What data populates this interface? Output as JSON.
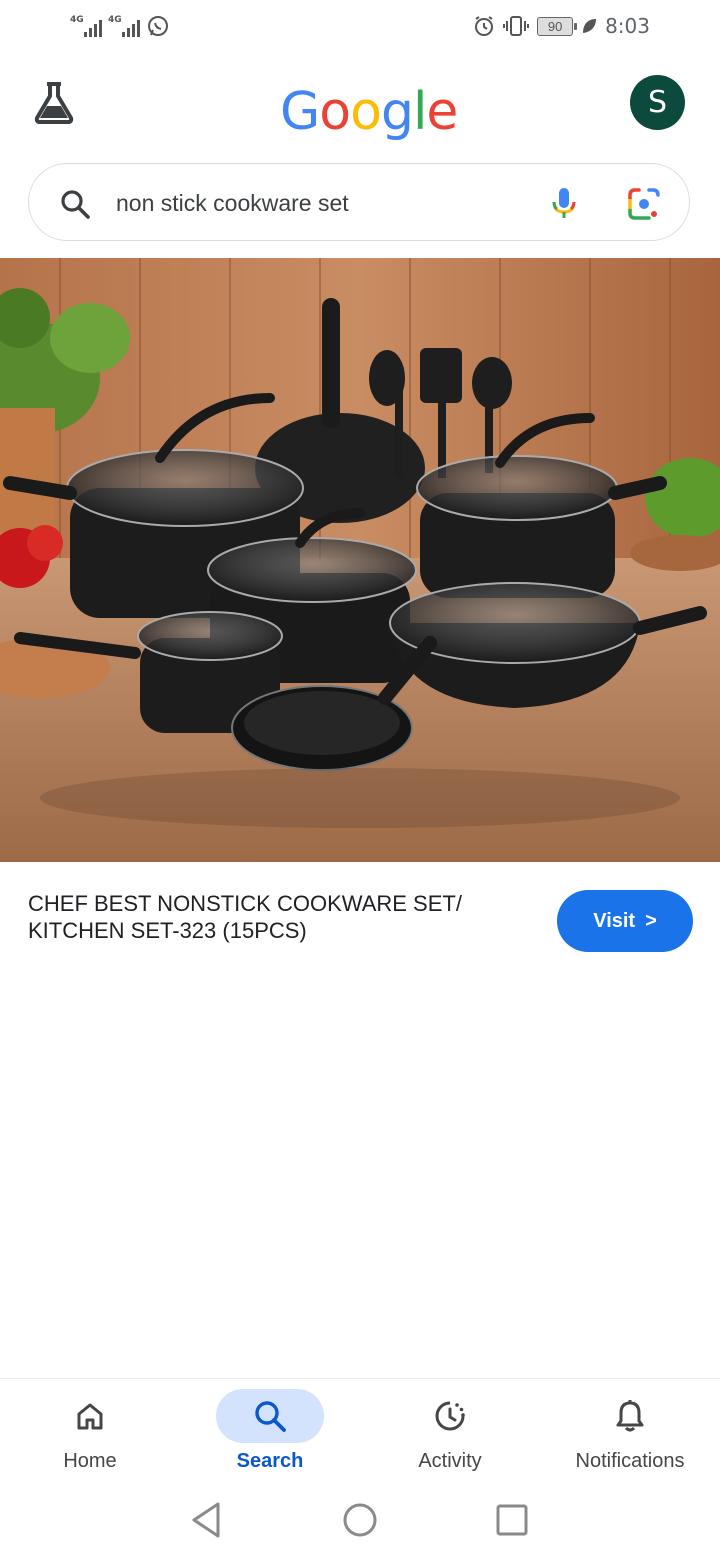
{
  "status_bar": {
    "network1": "4G",
    "network2": "4G",
    "battery": "90",
    "time": "8:03"
  },
  "header": {
    "logo_letters": [
      "G",
      "o",
      "o",
      "g",
      "l",
      "e"
    ],
    "logo_colors": [
      "#4285F4",
      "#EA4335",
      "#FBBC05",
      "#4285F4",
      "#34A853",
      "#EA4335"
    ],
    "avatar_initial": "S",
    "avatar_color": "#0c4a3e"
  },
  "search": {
    "query": "non stick cookware set"
  },
  "result": {
    "title": "CHEF BEST NONSTICK COOKWARE SET/ KITCHEN SET-323 (15PCS)",
    "visit_label": "Visit",
    "visit_chevron": ">",
    "accent": "#1a73e8"
  },
  "bottom_nav": {
    "items": [
      {
        "label": "Home",
        "icon": "home-icon"
      },
      {
        "label": "Search",
        "icon": "search-icon"
      },
      {
        "label": "Activity",
        "icon": "activity-icon"
      },
      {
        "label": "Notifications",
        "icon": "bell-icon"
      }
    ],
    "active_index": 1,
    "active_color": "#0b57d0"
  }
}
